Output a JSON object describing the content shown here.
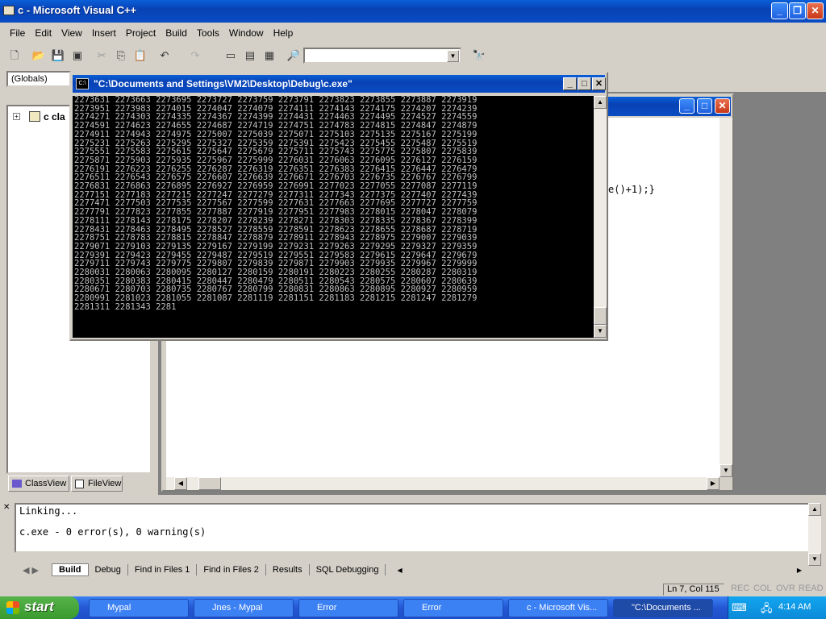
{
  "app": {
    "title": "c - Microsoft Visual C++"
  },
  "menu": [
    "File",
    "Edit",
    "View",
    "Insert",
    "Project",
    "Build",
    "Tools",
    "Window",
    "Help"
  ],
  "scope_combo": "(Globals)",
  "workspace": {
    "tree_item": "c cla",
    "tabs": [
      "ClassView",
      "FileView"
    ]
  },
  "editor": {
    "code_fragment": "e()+1);}"
  },
  "console": {
    "title": "\"C:\\Documents and Settings\\VM2\\Desktop\\Debug\\c.exe\"",
    "lines": [
      "2273631 2273663 2273695 2273727 2273759 2273791 2273823 2273855 2273887 2273919",
      "2273951 2273983 2274015 2274047 2274079 2274111 2274143 2274175 2274207 2274239",
      "2274271 2274303 2274335 2274367 2274399 2274431 2274463 2274495 2274527 2274559",
      "2274591 2274623 2274655 2274687 2274719 2274751 2274783 2274815 2274847 2274879",
      "2274911 2274943 2274975 2275007 2275039 2275071 2275103 2275135 2275167 2275199",
      "2275231 2275263 2275295 2275327 2275359 2275391 2275423 2275455 2275487 2275519",
      "2275551 2275583 2275615 2275647 2275679 2275711 2275743 2275775 2275807 2275839",
      "2275871 2275903 2275935 2275967 2275999 2276031 2276063 2276095 2276127 2276159",
      "2276191 2276223 2276255 2276287 2276319 2276351 2276383 2276415 2276447 2276479",
      "2276511 2276543 2276575 2276607 2276639 2276671 2276703 2276735 2276767 2276799",
      "2276831 2276863 2276895 2276927 2276959 2276991 2277023 2277055 2277087 2277119",
      "2277151 2277183 2277215 2277247 2277279 2277311 2277343 2277375 2277407 2277439",
      "2277471 2277503 2277535 2277567 2277599 2277631 2277663 2277695 2277727 2277759",
      "2277791 2277823 2277855 2277887 2277919 2277951 2277983 2278015 2278047 2278079",
      "2278111 2278143 2278175 2278207 2278239 2278271 2278303 2278335 2278367 2278399",
      "2278431 2278463 2278495 2278527 2278559 2278591 2278623 2278655 2278687 2278719",
      "2278751 2278783 2278815 2278847 2278879 2278911 2278943 2278975 2279007 2279039",
      "2279071 2279103 2279135 2279167 2279199 2279231 2279263 2279295 2279327 2279359",
      "2279391 2279423 2279455 2279487 2279519 2279551 2279583 2279615 2279647 2279679",
      "2279711 2279743 2279775 2279807 2279839 2279871 2279903 2279935 2279967 2279999",
      "2280031 2280063 2280095 2280127 2280159 2280191 2280223 2280255 2280287 2280319",
      "2280351 2280383 2280415 2280447 2280479 2280511 2280543 2280575 2280607 2280639",
      "2280671 2280703 2280735 2280767 2280799 2280831 2280863 2280895 2280927 2280959",
      "2280991 2281023 2281055 2281087 2281119 2281151 2281183 2281215 2281247 2281279",
      "2281311 2281343 2281"
    ]
  },
  "output": {
    "lines": [
      "Linking...",
      "",
      "c.exe - 0 error(s), 0 warning(s)"
    ],
    "tabs": [
      "Build",
      "Debug",
      "Find in Files 1",
      "Find in Files 2",
      "Results",
      "SQL Debugging"
    ]
  },
  "statusbar": {
    "position": "Ln 7, Col 115",
    "indicators": [
      "REC",
      "COL",
      "OVR",
      "READ"
    ]
  },
  "taskbar": {
    "start": "start",
    "items": [
      "Mypal",
      "Jnes - Mypal",
      "Error",
      "Error",
      "c - Microsoft Vis...",
      "\"C:\\Documents ..."
    ],
    "clock": "4:14 AM"
  }
}
